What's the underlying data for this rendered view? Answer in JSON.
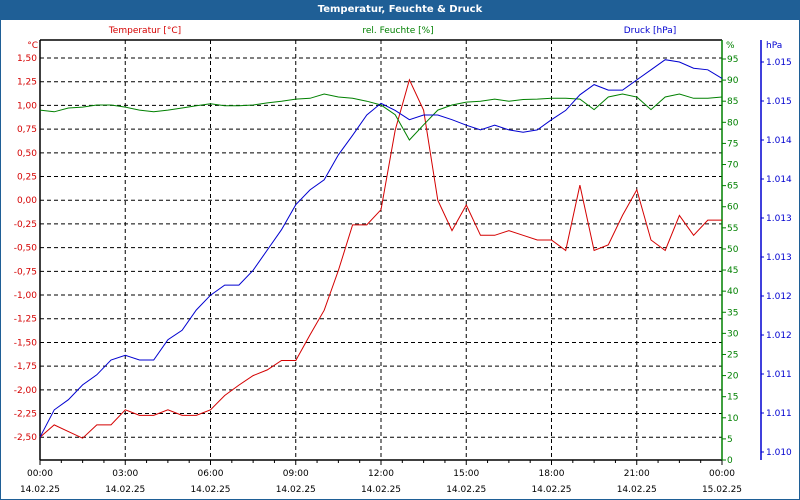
{
  "window": {
    "title": "Temperatur, Feuchte & Druck"
  },
  "colors": {
    "temperature": "#d40000",
    "humidity": "#008000",
    "pressure": "#0000d0",
    "titlebar": "#1f5f96"
  },
  "chart_data": {
    "type": "line",
    "title": "Temperatur, Feuchte & Druck",
    "grid": true,
    "x_hours": [
      0,
      0.5,
      1,
      1.5,
      2,
      2.5,
      3,
      3.5,
      4,
      4.5,
      5,
      5.5,
      6,
      6.5,
      7,
      7.5,
      8,
      8.5,
      9,
      9.5,
      10,
      10.5,
      11,
      11.5,
      12,
      12.5,
      13,
      13.5,
      14,
      14.5,
      15,
      15.5,
      16,
      16.5,
      17,
      17.5,
      18,
      18.5,
      19,
      19.5,
      20,
      20.5,
      21,
      21.5,
      22,
      22.5,
      23,
      23.5,
      24
    ],
    "x_ticks": [
      {
        "time": "00:00",
        "date": "14.02.25"
      },
      {
        "time": "03:00",
        "date": "14.02.25"
      },
      {
        "time": "06:00",
        "date": "14.02.25"
      },
      {
        "time": "09:00",
        "date": "14.02.25"
      },
      {
        "time": "12:00",
        "date": "14.02.25"
      },
      {
        "time": "15:00",
        "date": "14.02.25"
      },
      {
        "time": "18:00",
        "date": "14.02.25"
      },
      {
        "time": "21:00",
        "date": "14.02.25"
      },
      {
        "time": "00:00",
        "date": "15.02.25"
      }
    ],
    "axes": {
      "temperature": {
        "legend": "Temperatur [°C]",
        "unit": "°C",
        "range": [
          -2.74,
          1.69
        ],
        "ticks": [
          "1,50",
          "1,25",
          "1,00",
          "0,75",
          "0,50",
          "0,25",
          "0,00",
          "-0,25",
          "-0,50",
          "-0,75",
          "-1,00",
          "-1,25",
          "-1,50",
          "-1,75",
          "-2,00",
          "-2,25",
          "-2,50"
        ]
      },
      "humidity": {
        "legend": "rel. Feuchte [%]",
        "unit": "%",
        "range": [
          0,
          99.5
        ],
        "ticks": [
          "95",
          "90",
          "85",
          "80",
          "75",
          "70",
          "65",
          "60",
          "55",
          "50",
          "45",
          "40",
          "35",
          "30",
          "25",
          "20",
          "15",
          "10",
          "5",
          "0"
        ]
      },
      "pressure": {
        "legend": "Druck [hPa]",
        "unit": "hPa",
        "range": [
          1.01,
          1.015
        ],
        "ticks": [
          "1.015",
          "1.015",
          "1.014",
          "1.014",
          "1.013",
          "1.013",
          "1.012",
          "1.012",
          "1.011",
          "1.011",
          "1.010"
        ]
      }
    },
    "series": [
      {
        "name": "Temperatur [°C]",
        "axis": "temperature",
        "values": [
          -2.5,
          -2.37,
          -2.44,
          -2.51,
          -2.37,
          -2.37,
          -2.21,
          -2.27,
          -2.27,
          -2.21,
          -2.27,
          -2.27,
          -2.21,
          -2.06,
          -1.95,
          -1.85,
          -1.79,
          -1.69,
          -1.69,
          -1.42,
          -1.16,
          -0.74,
          -0.26,
          -0.26,
          -0.1,
          0.74,
          1.27,
          0.95,
          0.0,
          -0.32,
          -0.05,
          -0.37,
          -0.37,
          -0.32,
          -0.37,
          -0.42,
          -0.42,
          -0.53,
          0.16,
          -0.53,
          -0.47,
          -0.16,
          0.11,
          -0.42,
          -0.53,
          -0.16,
          -0.37,
          -0.21,
          -0.21
        ]
      },
      {
        "name": "rel. Feuchte [%]",
        "axis": "humidity",
        "values": [
          82.9,
          82.5,
          83.4,
          83.6,
          84.1,
          84.1,
          83.6,
          82.9,
          82.5,
          82.9,
          83.4,
          83.9,
          84.4,
          83.9,
          83.9,
          84.1,
          84.6,
          85.0,
          85.5,
          85.7,
          86.7,
          86.0,
          85.7,
          85.0,
          84.1,
          81.8,
          75.8,
          79.4,
          82.9,
          84.1,
          84.8,
          85.0,
          85.5,
          85.0,
          85.4,
          85.5,
          85.7,
          85.7,
          85.5,
          83.0,
          86.0,
          86.7,
          86.0,
          83.0,
          86.0,
          86.7,
          85.7,
          85.7,
          86.0
        ]
      },
      {
        "name": "Druck [hPa]",
        "axis": "pressure",
        "values": [
          1.01019,
          1.01054,
          1.01067,
          1.01086,
          1.01099,
          1.01118,
          1.01124,
          1.01118,
          1.01118,
          1.01144,
          1.01156,
          1.01182,
          1.01201,
          1.01214,
          1.01214,
          1.01233,
          1.01259,
          1.01285,
          1.01317,
          1.01336,
          1.01349,
          1.01381,
          1.01406,
          1.01432,
          1.01447,
          1.01438,
          1.01426,
          1.01432,
          1.01432,
          1.01426,
          1.01419,
          1.01413,
          1.01419,
          1.01413,
          1.0141,
          1.01413,
          1.01426,
          1.01438,
          1.01458,
          1.01471,
          1.01464,
          1.01464,
          1.01477,
          1.0149,
          1.01503,
          1.015,
          1.01492,
          1.0149,
          1.01479
        ]
      }
    ]
  }
}
